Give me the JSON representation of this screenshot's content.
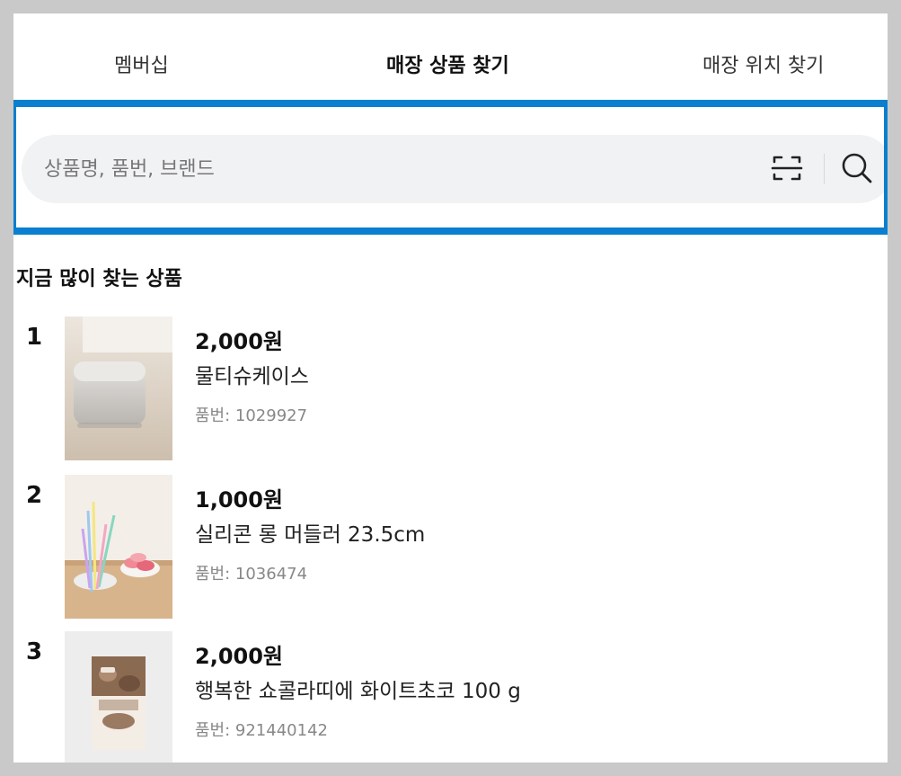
{
  "tabs": {
    "membership": "멤버십",
    "products": "매장 상품 찾기",
    "location": "매장 위치 찾기",
    "active": "매장 상품 찾기"
  },
  "search": {
    "placeholder": "상품명, 품번, 브랜드",
    "value": "",
    "scan_icon": "barcode-scan-icon",
    "search_icon": "search-icon"
  },
  "highlight_color": "#0a7fcf",
  "section": {
    "title": "지금 많이 찾는 상품"
  },
  "products": [
    {
      "rank": "1",
      "price": "2,000원",
      "name": "물티슈케이스",
      "sku": "품번: 1029927"
    },
    {
      "rank": "2",
      "price": "1,000원",
      "name": "실리콘 롱 머들러 23.5cm",
      "sku": "품번: 1036474"
    },
    {
      "rank": "3",
      "price": "2,000원",
      "name": "행복한 쇼콜라띠에 화이트초코 100 g",
      "sku": "품번: 921440142"
    }
  ]
}
